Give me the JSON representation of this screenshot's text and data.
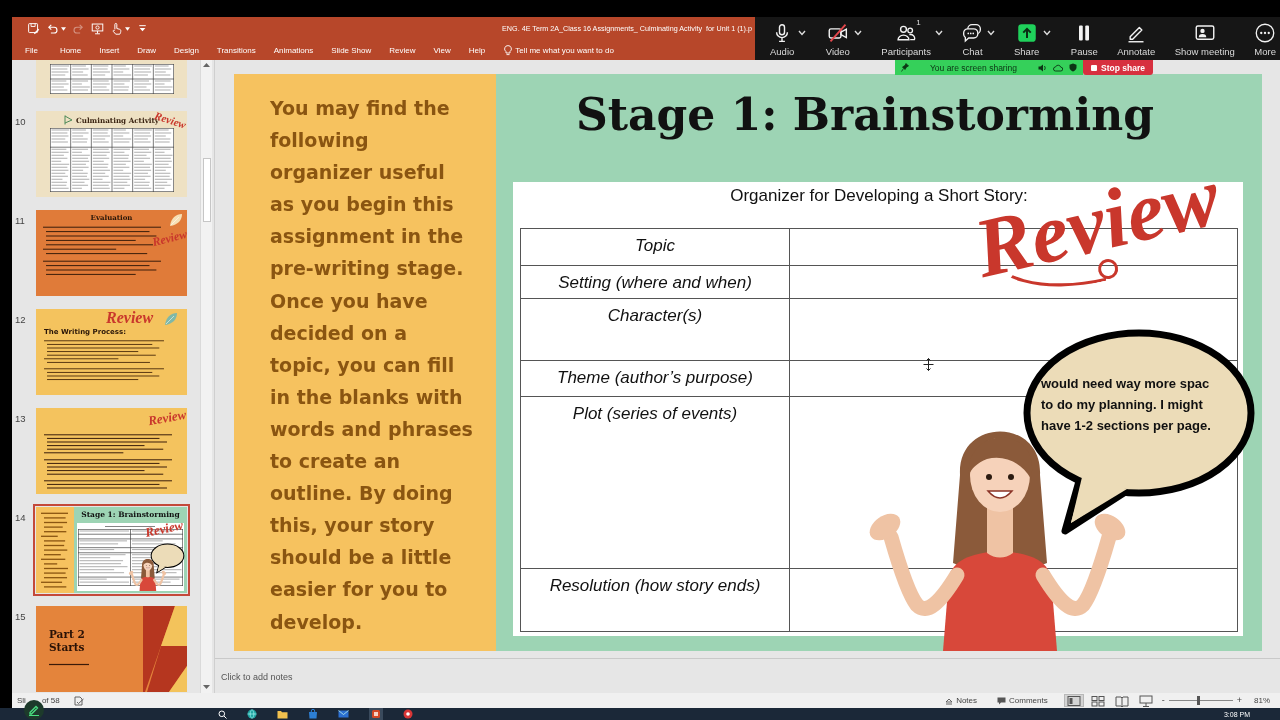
{
  "title_bar": {
    "quick_access": [
      {
        "kind": "save",
        "disabled": false,
        "menu": false
      },
      {
        "kind": "undo",
        "disabled": false,
        "menu": true
      },
      {
        "kind": "redo",
        "disabled": true,
        "menu": false
      },
      {
        "kind": "present",
        "disabled": false,
        "menu": false
      },
      {
        "kind": "touch",
        "disabled": false,
        "menu": true
      },
      {
        "kind": "customize",
        "disabled": false,
        "menu": false
      }
    ],
    "title": "ENG. 4E Term 2A_Class 16 Assignments_ Culminating Activity  for Unit 1 (1).p"
  },
  "ribbon": {
    "tabs": [
      {
        "label": "File",
        "selected": false
      },
      {
        "label": "Home",
        "selected": false
      },
      {
        "label": "Insert",
        "selected": false
      },
      {
        "label": "Draw",
        "selected": false
      },
      {
        "label": "Design",
        "selected": false
      },
      {
        "label": "Transitions",
        "selected": false
      },
      {
        "label": "Animations",
        "selected": false
      },
      {
        "label": "Slide Show",
        "selected": false
      },
      {
        "label": "Review",
        "selected": false
      },
      {
        "label": "View",
        "selected": false
      },
      {
        "label": "Help",
        "selected": false
      }
    ],
    "tell_me": {
      "placeholder": "Tell me what you want to do"
    }
  },
  "zoom_toolbar": {
    "buttons": [
      {
        "kind": "audio",
        "label": "Audio",
        "muted": false,
        "menu": true
      },
      {
        "kind": "video",
        "label": "Video",
        "on": false,
        "menu": true
      },
      {
        "kind": "participants",
        "label": "Participants",
        "count": "1",
        "menu": true
      },
      {
        "kind": "chat",
        "label": "Chat",
        "menu": true
      },
      {
        "kind": "share",
        "label": "Share",
        "menu": true
      },
      {
        "kind": "pause",
        "label": "Pause",
        "menu": false
      },
      {
        "kind": "annotate",
        "label": "Annotate",
        "menu": false
      },
      {
        "kind": "show_meeting",
        "label": "Show meeting",
        "menu": false
      },
      {
        "kind": "more",
        "label": "More",
        "menu": false
      }
    ],
    "sharing_banner": {
      "text": "You are screen sharing",
      "stop_button": "Stop share"
    }
  },
  "thumbnails": [
    {
      "kind": "table",
      "selected": false
    },
    {
      "number": "10",
      "kind": "rubric",
      "title": "Culminating Activity",
      "stamp": "Review",
      "selected": false
    },
    {
      "number": "11",
      "kind": "evaluation",
      "title": "Evaluation",
      "stamp": "Review",
      "selected": false
    },
    {
      "number": "12",
      "kind": "process",
      "title": "The Writing Process:",
      "stamp": "Review",
      "selected": false
    },
    {
      "number": "13",
      "kind": "notes",
      "stamp": "Review",
      "selected": false
    },
    {
      "number": "14",
      "kind": "brainstorm",
      "title": "Stage 1: Brainstorming",
      "stamp": "Review",
      "selected": true
    },
    {
      "number": "15",
      "kind": "section",
      "title": "Part 2 Starts",
      "selected": false
    }
  ],
  "slide": {
    "sidebar_lines": [
      "You may find the",
      "following",
      "organizer useful",
      "as you begin this",
      "assignment in the",
      "pre-writing stage.",
      "Once you have",
      "decided on a",
      "topic, you can fill",
      "in the blanks with",
      "words and phrases",
      "to create an",
      "outline. By doing",
      "this, your story",
      "should be a little",
      "easier for you to",
      "develop."
    ],
    "title": "Stage 1: Brainstorming",
    "organizer": {
      "title": "Organizer for Developing a Short Story:",
      "rows": [
        {
          "label": "Topic"
        },
        {
          "label": "Setting (where and when)"
        },
        {
          "label": "Character(s)"
        },
        {
          "label": "Theme (author’s purpose)"
        },
        {
          "label": "Plot (series of events)"
        },
        {
          "label": "Resolution (how story ends)"
        }
      ]
    },
    "stamp": "Review",
    "speech_bubble": {
      "lines": [
        "would need way more spac",
        "to do my planning. I might",
        "have 1-2 sections per page."
      ]
    }
  },
  "notes": {
    "placeholder": "Click to add notes"
  },
  "status_bar": {
    "counter_start": "Sli",
    "counter_end": "of 58",
    "notes": "Notes",
    "comments": "Comments",
    "views": [
      {
        "selected": true
      },
      {
        "selected": false
      },
      {
        "selected": false
      },
      {
        "selected": false
      }
    ],
    "zoom_out": "-",
    "zoom_in": "+",
    "zoom": {
      "level": 0.46,
      "reading": "81%"
    }
  },
  "taskbar": {
    "clock": "3:08 PM"
  }
}
